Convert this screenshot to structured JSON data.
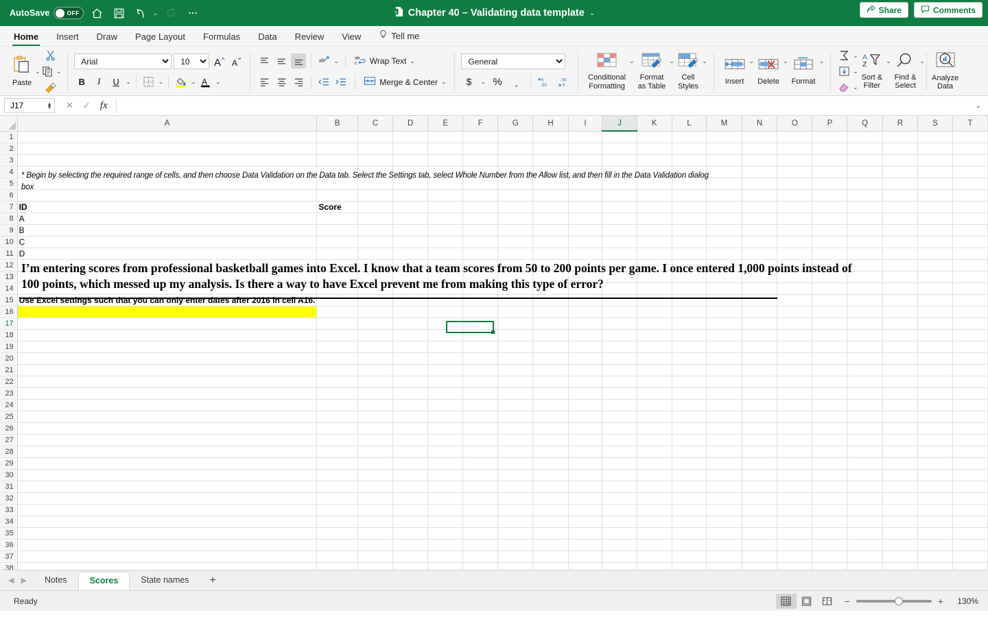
{
  "titlebar": {
    "autosave_label": "AutoSave",
    "autosave_state": "OFF",
    "document_title": "Chapter 40 – Validating data template",
    "icons": [
      "home-icon",
      "save-icon",
      "undo-icon",
      "redo-icon",
      "more-icon",
      "search-icon",
      "account-icon"
    ]
  },
  "ribbon": {
    "tabs": [
      {
        "label": "Home",
        "active": true
      },
      {
        "label": "Insert",
        "active": false
      },
      {
        "label": "Draw",
        "active": false
      },
      {
        "label": "Page Layout",
        "active": false
      },
      {
        "label": "Formulas",
        "active": false
      },
      {
        "label": "Data",
        "active": false
      },
      {
        "label": "Review",
        "active": false
      },
      {
        "label": "View",
        "active": false
      },
      {
        "label": "Tell me",
        "active": false
      }
    ],
    "share_label": "Share",
    "comments_label": "Comments",
    "clipboard": {
      "paste_label": "Paste",
      "cut": "cut-icon",
      "copy": "copy-icon",
      "format_painter": "format-painter-icon"
    },
    "font": {
      "family_value": "Arial",
      "size_value": "10",
      "grow": "A˄",
      "shrink": "A˅",
      "bold": "B",
      "italic": "I",
      "underline": "U",
      "borders": "borders-icon",
      "fill_color": "#ffff00",
      "font_color": "#000000"
    },
    "alignment": {
      "wrap_text_label": "Wrap Text",
      "merge_center_label": "Merge & Center"
    },
    "number": {
      "format_value": "General",
      "currency": "$",
      "percent": "%",
      "comma": "͵"
    },
    "styles": [
      {
        "label_line1": "Conditional",
        "label_line2": "Formatting"
      },
      {
        "label_line1": "Format",
        "label_line2": "as Table"
      },
      {
        "label_line1": "Cell",
        "label_line2": "Styles"
      }
    ],
    "cells": [
      {
        "label": "Insert"
      },
      {
        "label": "Delete"
      },
      {
        "label": "Format"
      }
    ],
    "editing": [
      {
        "label_line1": "Sort &",
        "label_line2": "Filter"
      },
      {
        "label_line1": "Find &",
        "label_line2": "Select"
      },
      {
        "label_line1": "Analyze",
        "label_line2": "Data"
      }
    ]
  },
  "formula_bar": {
    "name_box_value": "J17",
    "formula_value": "",
    "cancel_icon": "cancel-icon",
    "enter_icon": "enter-icon",
    "function_icon": "fx"
  },
  "grid": {
    "columns": [
      "A",
      "B",
      "C",
      "D",
      "E",
      "F",
      "G",
      "H",
      "I",
      "J",
      "K",
      "L",
      "M",
      "N",
      "O",
      "P",
      "Q",
      "R",
      "S",
      "T"
    ],
    "selected_column": "J",
    "selected_row": 17,
    "selected_cell": "J17",
    "row_count": 38,
    "question_line1": "I’m entering scores from professional basketball games into Excel. I know that a team scores from 50 to 200 points per game. I once entered 1,000 points instead of",
    "question_line2": "100 points, which messed up my analysis. Is there a way to have Excel prevent me from making this type of error?",
    "answer_line1": "* Begin by selecting the required range of cells, and then choose Data Validation on the Data tab. Select the Settings tab, select Whole Number from the Allow list, and then fill in the Data Validation dialog",
    "answer_line2": "box",
    "header_id": "ID",
    "header_score": "Score",
    "ids": [
      "A",
      "B",
      "C",
      "D"
    ],
    "task_text": "Use Excel settings such that you can only enter dates after 2016 in cell A16.",
    "highlight_cell": "A16",
    "highlight_color": "#ffff00"
  },
  "sheet_tabs": {
    "tabs": [
      {
        "label": "Notes",
        "active": false
      },
      {
        "label": "Scores",
        "active": true
      },
      {
        "label": "State names",
        "active": false
      }
    ],
    "add_label": "+"
  },
  "status_bar": {
    "status_text": "Ready",
    "view_normal": "normal-view-icon",
    "view_page_layout": "page-layout-view-icon",
    "view_page_break": "page-break-view-icon",
    "zoom_out": "−",
    "zoom_in": "+",
    "zoom_value": "130%"
  }
}
